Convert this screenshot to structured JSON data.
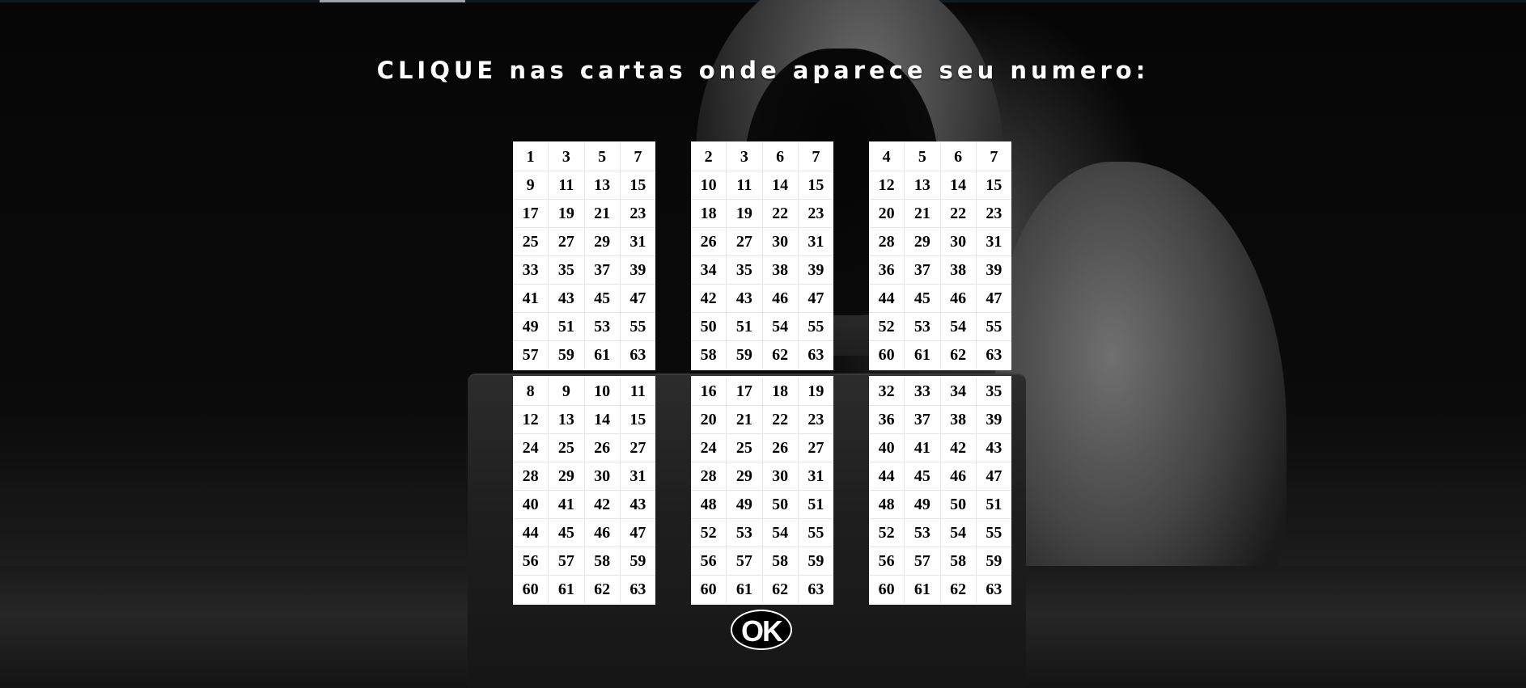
{
  "title": "CLIQUE nas cartas onde aparece seu numero:",
  "cards": [
    {
      "rows": [
        [
          "1",
          "3",
          "5",
          "7"
        ],
        [
          "9",
          "11",
          "13",
          "15"
        ],
        [
          "17",
          "19",
          "21",
          "23"
        ],
        [
          "25",
          "27",
          "29",
          "31"
        ],
        [
          "33",
          "35",
          "37",
          "39"
        ],
        [
          "41",
          "43",
          "45",
          "47"
        ],
        [
          "49",
          "51",
          "53",
          "55"
        ],
        [
          "57",
          "59",
          "61",
          "63"
        ]
      ]
    },
    {
      "rows": [
        [
          "2",
          "3",
          "6",
          "7"
        ],
        [
          "10",
          "11",
          "14",
          "15"
        ],
        [
          "18",
          "19",
          "22",
          "23"
        ],
        [
          "26",
          "27",
          "30",
          "31"
        ],
        [
          "34",
          "35",
          "38",
          "39"
        ],
        [
          "42",
          "43",
          "46",
          "47"
        ],
        [
          "50",
          "51",
          "54",
          "55"
        ],
        [
          "58",
          "59",
          "62",
          "63"
        ]
      ]
    },
    {
      "rows": [
        [
          "4",
          "5",
          "6",
          "7"
        ],
        [
          "12",
          "13",
          "14",
          "15"
        ],
        [
          "20",
          "21",
          "22",
          "23"
        ],
        [
          "28",
          "29",
          "30",
          "31"
        ],
        [
          "36",
          "37",
          "38",
          "39"
        ],
        [
          "44",
          "45",
          "46",
          "47"
        ],
        [
          "52",
          "53",
          "54",
          "55"
        ],
        [
          "60",
          "61",
          "62",
          "63"
        ]
      ]
    },
    {
      "rows": [
        [
          "8",
          "9",
          "10",
          "11"
        ],
        [
          "12",
          "13",
          "14",
          "15"
        ],
        [
          "24",
          "25",
          "26",
          "27"
        ],
        [
          "28",
          "29",
          "30",
          "31"
        ],
        [
          "40",
          "41",
          "42",
          "43"
        ],
        [
          "44",
          "45",
          "46",
          "47"
        ],
        [
          "56",
          "57",
          "58",
          "59"
        ],
        [
          "60",
          "61",
          "62",
          "63"
        ]
      ]
    },
    {
      "rows": [
        [
          "16",
          "17",
          "18",
          "19"
        ],
        [
          "20",
          "21",
          "22",
          "23"
        ],
        [
          "24",
          "25",
          "26",
          "27"
        ],
        [
          "28",
          "29",
          "30",
          "31"
        ],
        [
          "48",
          "49",
          "50",
          "51"
        ],
        [
          "52",
          "53",
          "54",
          "55"
        ],
        [
          "56",
          "57",
          "58",
          "59"
        ],
        [
          "60",
          "61",
          "62",
          "63"
        ]
      ]
    },
    {
      "rows": [
        [
          "32",
          "33",
          "34",
          "35"
        ],
        [
          "36",
          "37",
          "38",
          "39"
        ],
        [
          "40",
          "41",
          "42",
          "43"
        ],
        [
          "44",
          "45",
          "46",
          "47"
        ],
        [
          "48",
          "49",
          "50",
          "51"
        ],
        [
          "52",
          "53",
          "54",
          "55"
        ],
        [
          "56",
          "57",
          "58",
          "59"
        ],
        [
          "60",
          "61",
          "62",
          "63"
        ]
      ]
    }
  ],
  "ok_button": {
    "label": "OK"
  },
  "colors": {
    "background": "#050505",
    "card": "#ffffff",
    "text": "#ffffff"
  },
  "background_image": "hooded-hacker-with-laptop"
}
